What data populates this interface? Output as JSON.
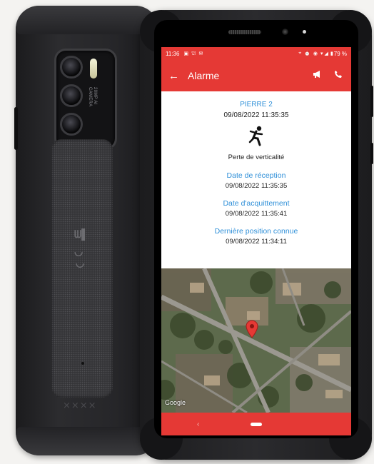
{
  "status_bar": {
    "time": "11:36",
    "battery": "79 %",
    "left_icons": [
      "image-icon",
      "person-icon",
      "message-icon"
    ],
    "right_icons": [
      "location-icon",
      "alarm-icon",
      "eye-icon",
      "wifi-icon",
      "signal-icon",
      "battery-icon"
    ]
  },
  "app_bar": {
    "title": "Alarme",
    "icons": [
      "back-arrow-icon",
      "megaphone-icon",
      "phone-icon"
    ]
  },
  "alarm": {
    "name": "PIERRE 2",
    "datetime": "09/08/2022 11:35:35",
    "event_icon": "falling-person-icon",
    "event_label": "Perte de verticalité"
  },
  "details": [
    {
      "label": "Date de réception",
      "value": "09/08/2022 11:35:35"
    },
    {
      "label": "Date d'acquittement",
      "value": "09/08/2022 11:35:41"
    },
    {
      "label": "Dernière position connue",
      "value": "09/08/2022 11:34:11"
    }
  ],
  "map": {
    "attribution": "Google",
    "marker_icon": "map-pin-icon"
  },
  "device": {
    "camera_text_line1": "20MP AI",
    "camera_text_line2": "CAMERA"
  },
  "colors": {
    "accent": "#e53935",
    "link": "#2e8fd8"
  }
}
